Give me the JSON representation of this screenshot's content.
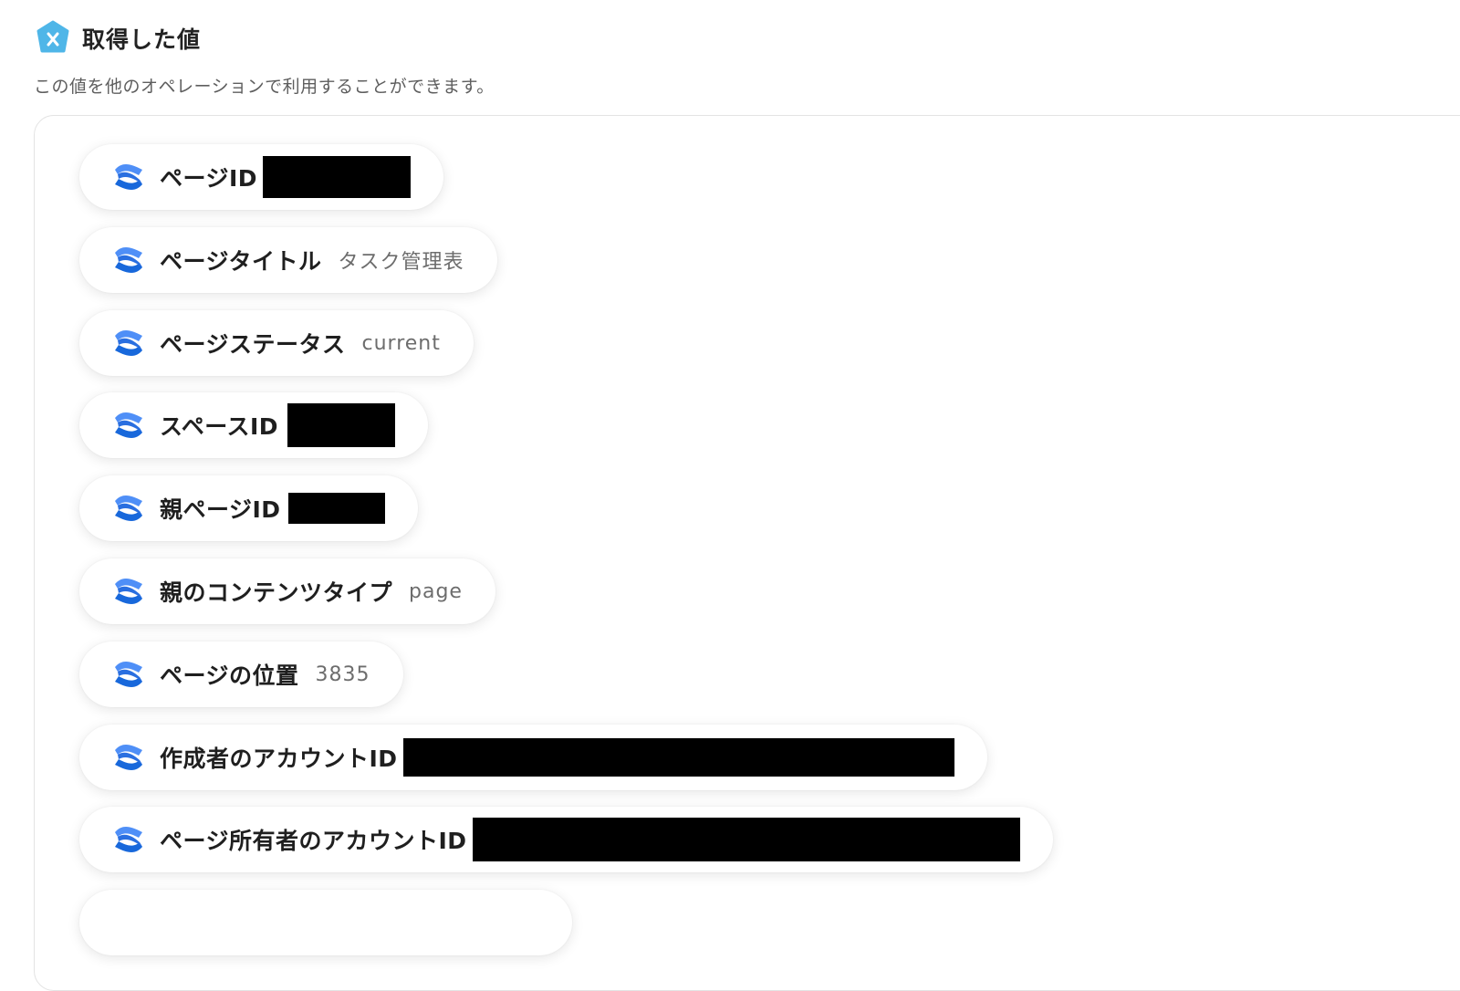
{
  "header": {
    "icon": "hexagon-x-icon",
    "title": "取得した値",
    "subtitle": "この値を他のオペレーションで利用することができます。",
    "accent_color": "#4fb6e8"
  },
  "items": [
    {
      "label": "ページID",
      "value": "",
      "redacted": true,
      "icon": "confluence-icon"
    },
    {
      "label": "ページタイトル",
      "value": "タスク管理表",
      "redacted": false,
      "icon": "confluence-icon"
    },
    {
      "label": "ページステータス",
      "value": "current",
      "redacted": false,
      "icon": "confluence-icon"
    },
    {
      "label": "スペースID",
      "value": "",
      "redacted": true,
      "icon": "confluence-icon"
    },
    {
      "label": "親ページID",
      "value": "",
      "redacted": true,
      "icon": "confluence-icon"
    },
    {
      "label": "親のコンテンツタイプ",
      "value": "page",
      "redacted": false,
      "icon": "confluence-icon"
    },
    {
      "label": "ページの位置",
      "value": "3835",
      "redacted": false,
      "icon": "confluence-icon"
    },
    {
      "label": "作成者のアカウントID",
      "value": "",
      "redacted": true,
      "icon": "confluence-icon"
    },
    {
      "label": "ページ所有者のアカウントID",
      "value": "",
      "redacted": true,
      "icon": "confluence-icon"
    }
  ],
  "colors": {
    "confluence_blue_dark": "#1868db",
    "confluence_blue_light": "#4f8ff7",
    "redaction": "#000000"
  }
}
